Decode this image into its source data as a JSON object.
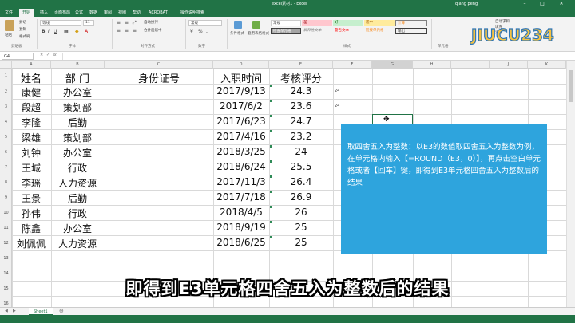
{
  "window": {
    "title": "excel素材1 - Excel",
    "user": "qiang peng"
  },
  "ribbon_tabs": [
    "文件",
    "开始",
    "插入",
    "页面布局",
    "公式",
    "数据",
    "审阅",
    "视图",
    "帮助",
    "ACROBAT",
    "操作说明搜索"
  ],
  "ribbon": {
    "font_name": "等线",
    "font_size": "11",
    "paste_label": "粘贴",
    "cut_label": "剪切",
    "copy_label": "复制",
    "format_painter_label": "格式刷",
    "groups": {
      "clipboard": "剪贴板",
      "font": "字体",
      "alignment": "对齐方式",
      "number": "数字",
      "styles": "样式",
      "cells": "单元格"
    },
    "wrap_label": "自动换行",
    "merge_label": "合并后居中",
    "number_format": "常规",
    "cond_format_label": "条件格式",
    "table_format_label": "套用表格格式",
    "styles": {
      "normal": "常规",
      "bad": "差",
      "good": "好",
      "neutral": "适中",
      "calc": "计算",
      "check": "检查单元格",
      "explain": "解释性文本",
      "warning": "警告文本",
      "link": "链接单元格",
      "output": "输出"
    },
    "autosum_label": "自动求和",
    "fill_label": "填充",
    "clear_label": "清除",
    "colors": {
      "bad_bg": "#ffc7ce",
      "good_bg": "#c6efce",
      "neutral_bg": "#ffeb9c",
      "calc_bg": "#f2f2f2",
      "check_bg": "#a5a5a5"
    }
  },
  "namebox": "G4",
  "columns": [
    "A",
    "B",
    "C",
    "D",
    "E",
    "F",
    "G",
    "H",
    "I",
    "J",
    "K",
    "L",
    "M"
  ],
  "rows": [
    "1",
    "2",
    "3",
    "4",
    "5",
    "6",
    "7",
    "8",
    "9",
    "10",
    "11",
    "12",
    "13",
    "14",
    "15",
    "16"
  ],
  "table": {
    "headers": [
      "姓名",
      "部  门",
      "身份证号",
      "入职时间",
      "考核评分"
    ],
    "rows": [
      [
        "康健",
        "办公室",
        "",
        "2017/9/13",
        "24.3"
      ],
      [
        "段超",
        "策划部",
        "",
        "2017/6/2",
        "23.6"
      ],
      [
        "李隆",
        "后勤",
        "",
        "2017/6/23",
        "24.7"
      ],
      [
        "梁雄",
        "策划部",
        "",
        "2017/4/16",
        "23.2"
      ],
      [
        "刘钟",
        "办公室",
        "",
        "2018/3/25",
        "24"
      ],
      [
        "王城",
        "行政",
        "",
        "2018/6/24",
        "25.5"
      ],
      [
        "李瑶",
        "人力资源",
        "",
        "2017/11/3",
        "26.4"
      ],
      [
        "王景",
        "后勤",
        "",
        "2017/7/18",
        "26.9"
      ],
      [
        "孙伟",
        "行政",
        "",
        "2018/4/5",
        "26"
      ],
      [
        "陈鑫",
        "办公室",
        "",
        "2018/9/19",
        "25"
      ],
      [
        "刘佩佩",
        "人力资源",
        "",
        "2018/6/25",
        "25"
      ]
    ],
    "f_values": [
      "24",
      "24"
    ]
  },
  "info_box": "取四舍五入为整数：以E3的数值取四舍五入为整数为例，在单元格内输入【=ROUND（E3，0）】，再点击空白单元格或者【回车】键，即得到E3单元格四舍五入为整数后的结果",
  "subtitle": "即得到E3单元格四舍五入为整数后的结果",
  "sheet_tab": "Sheet1",
  "logo_text": "JIUCU234",
  "accent": "#217346",
  "info_box_color": "#2ea4dd"
}
